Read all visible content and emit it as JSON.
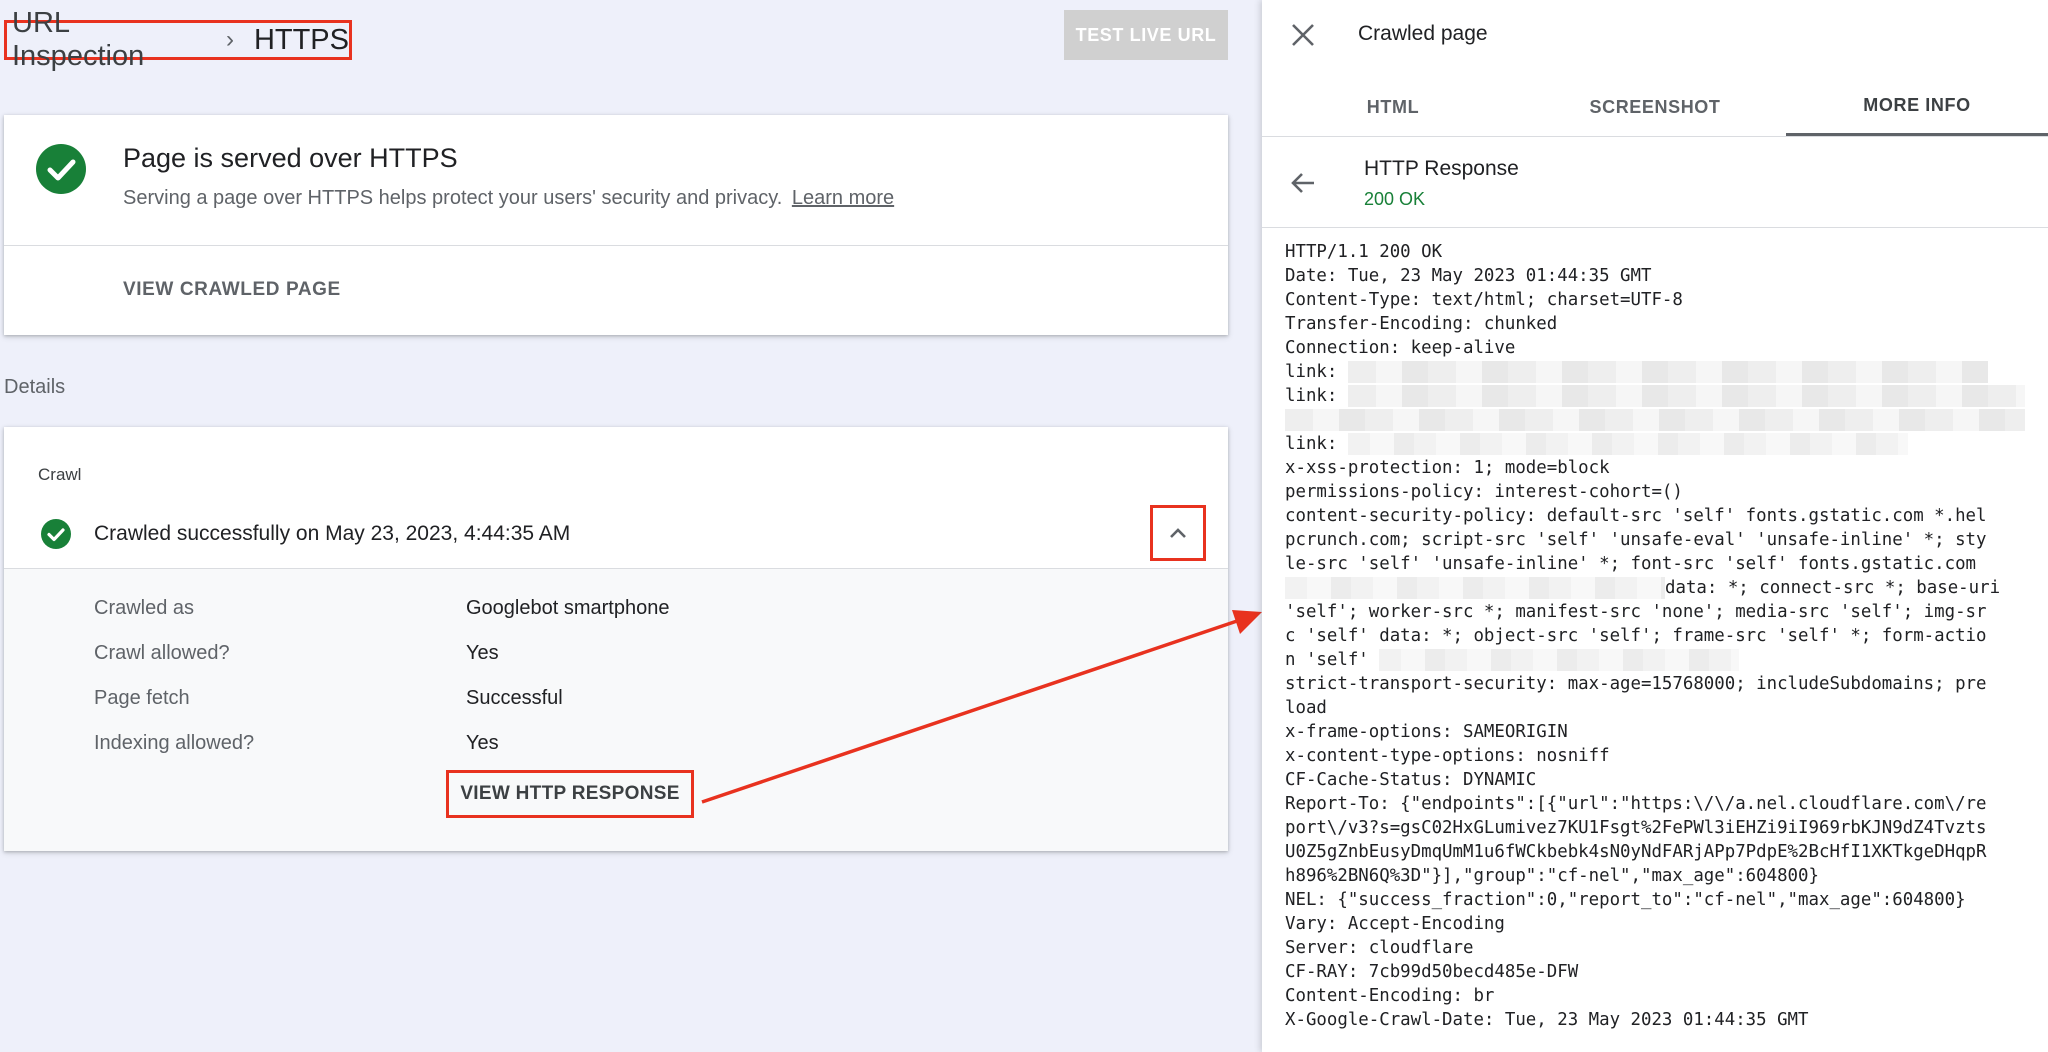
{
  "breadcrumb": {
    "parent": "URL Inspection",
    "separator": "›",
    "current": "HTTPS"
  },
  "toolbar": {
    "test_live_label": "TEST LIVE URL"
  },
  "https_card": {
    "title": "Page is served over HTTPS",
    "description": "Serving a page over HTTPS helps protect your users' security and privacy.",
    "learn_more": "Learn more",
    "view_crawled": "VIEW CRAWLED PAGE"
  },
  "details_label": "Details",
  "crawl_card": {
    "section_label": "Crawl",
    "status": "Crawled successfully on May 23, 2023, 4:44:35 AM",
    "rows": [
      {
        "key": "Crawled as",
        "value": "Googlebot smartphone"
      },
      {
        "key": "Crawl allowed?",
        "value": "Yes"
      },
      {
        "key": "Page fetch",
        "value": "Successful"
      },
      {
        "key": "Indexing allowed?",
        "value": "Yes"
      }
    ],
    "view_http_response": "VIEW HTTP RESPONSE"
  },
  "panel": {
    "title": "Crawled page",
    "tabs": [
      "HTML",
      "SCREENSHOT",
      "MORE INFO"
    ],
    "active_tab": "MORE INFO",
    "response_title": "HTTP Response",
    "response_status": "200 OK",
    "lines": [
      "HTTP/1.1 200 OK",
      "Date: Tue, 23 May 2023 01:44:35 GMT",
      "Content-Type: text/html; charset=UTF-8",
      "Transfer-Encoding: chunked",
      "Connection: keep-alive",
      "link: ",
      "link: ",
      "",
      "link: ",
      "x-xss-protection: 1; mode=block",
      "permissions-policy: interest-cohort=()",
      "content-security-policy: default-src 'self' fonts.gstatic.com *.hel",
      "pcrunch.com; script-src 'self' 'unsafe-eval' 'unsafe-inline' *; sty",
      "le-src 'self' 'unsafe-inline' *; font-src 'self' fonts.gstatic.com",
      "data: *; connect-src *; base-uri",
      "'self'; worker-src *; manifest-src 'none'; media-src 'self'; img-sr",
      "c 'self' data: *; object-src 'self'; frame-src 'self' *; form-actio",
      "n 'self' ",
      "strict-transport-security: max-age=15768000; includeSubdomains; pre",
      "load",
      "x-frame-options: SAMEORIGIN",
      "x-content-type-options: nosniff",
      "CF-Cache-Status: DYNAMIC",
      "Report-To: {\"endpoints\":[{\"url\":\"https:\\/\\/a.nel.cloudflare.com\\/re",
      "port\\/v3?s=gsC02HxGLumivez7KU1Fsgt%2FePWl3iEHZi9iI969rbKJN9dZ4Tvzts",
      "U0Z5gZnbEusyDmqUmM1u6fWCkbebk4sN0yNdFARjAPp7PdpE%2BcHfI1XKTkgeDHqpR",
      "h896%2BN6Q%3D\"}],\"group\":\"cf-nel\",\"max_age\":604800}",
      "NEL: {\"success_fraction\":0,\"report_to\":\"cf-nel\",\"max_age\":604800}",
      "Vary: Accept-Encoding",
      "Server: cloudflare",
      "CF-RAY: 7cb99d50becd485e-DFW",
      "Content-Encoding: br",
      "X-Google-Crawl-Date: Tue, 23 May 2023 01:44:35 GMT"
    ]
  },
  "colors": {
    "success": "#188038",
    "highlight": "#e8321f",
    "background": "#eef0fa"
  }
}
